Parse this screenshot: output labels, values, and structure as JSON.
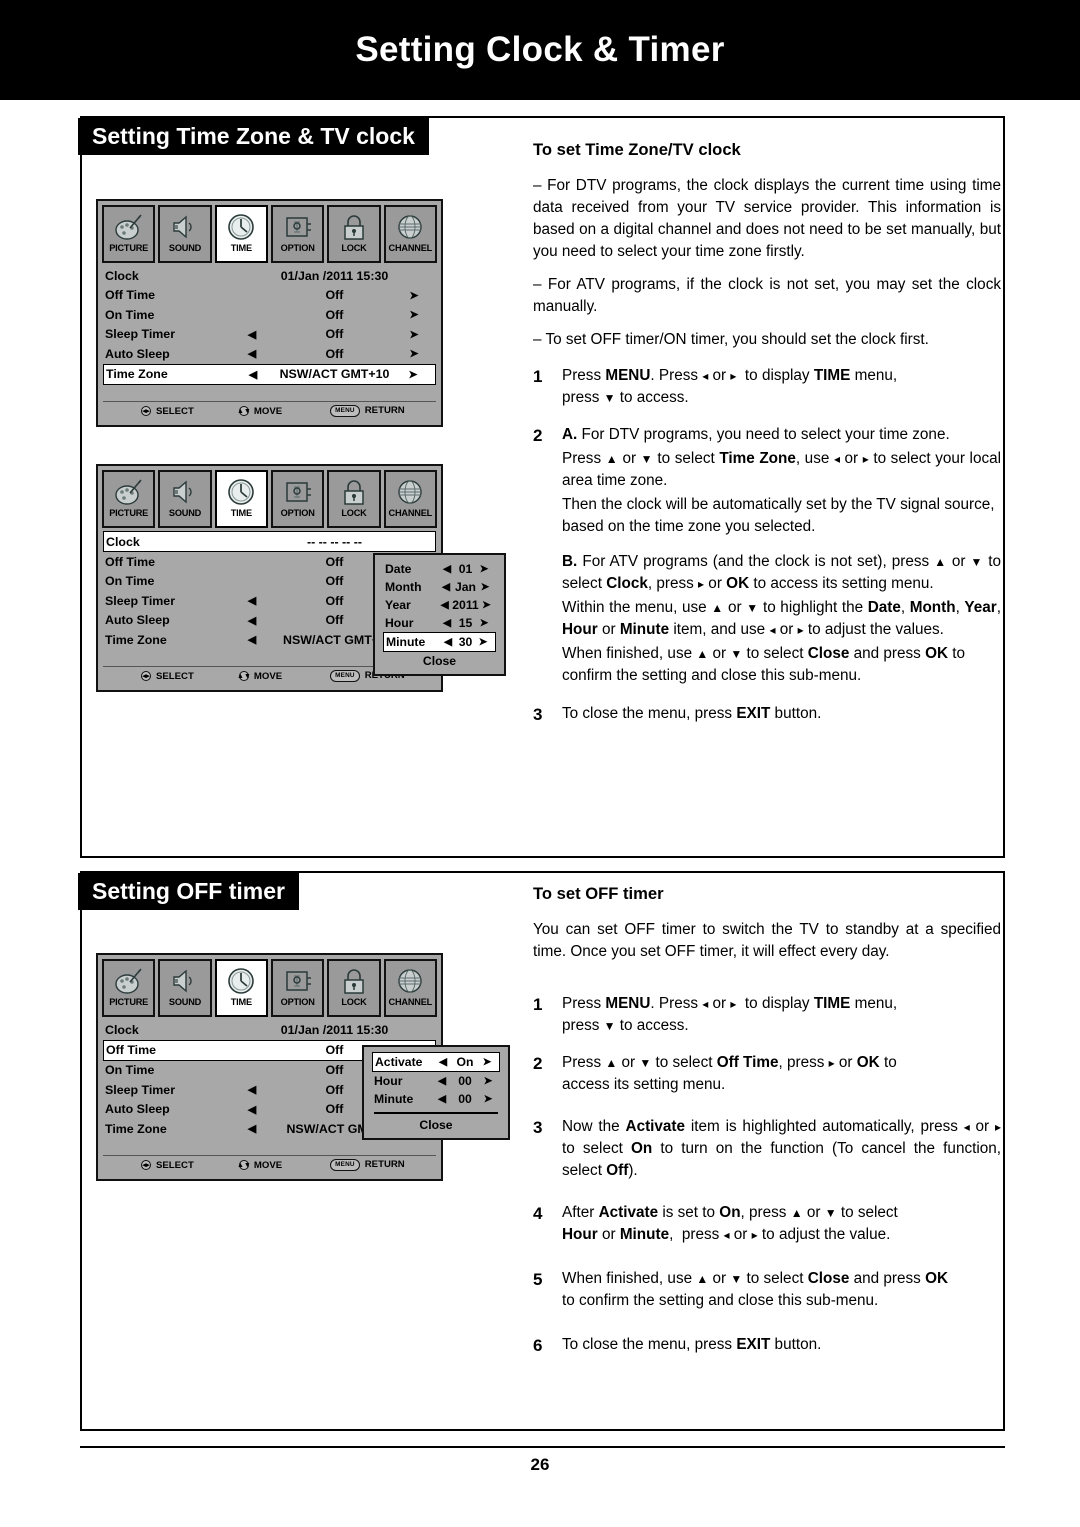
{
  "page": {
    "banner_title": "Setting Clock & Timer",
    "page_number": "26"
  },
  "sections": {
    "timezone": {
      "tag": "Setting Time Zone & TV clock",
      "subhead": "To set Time Zone/TV clock",
      "paragraphs": [
        "– For DTV programs, the clock displays the current time using time data received from your TV service provider. This information is based on a digital channel and does not need to be set manually, but you need to select your time zone firstly.",
        "– For ATV programs, if the clock is not set, you may set the clock manually.",
        "– To set OFF timer/ON timer, you should set the clock first."
      ],
      "steps": [
        {
          "num": "1"
        },
        {
          "num": "2"
        },
        {
          "num": "3"
        }
      ]
    },
    "offtimer": {
      "tag": "Setting OFF timer",
      "subhead": "To set OFF timer",
      "paragraphs": [
        "You can set OFF timer to switch the TV to standby at a specified time.  Once you set OFF timer, it will effect every day."
      ],
      "steps": [
        {
          "num": "1"
        },
        {
          "num": "2"
        },
        {
          "num": "3"
        },
        {
          "num": "4"
        },
        {
          "num": "5"
        },
        {
          "num": "6"
        }
      ]
    }
  },
  "osd": {
    "icons": [
      {
        "label": "PICTURE",
        "icon": "picture-palette-icon"
      },
      {
        "label": "SOUND",
        "icon": "speaker-icon"
      },
      {
        "label": "TIME",
        "icon": "clock-icon"
      },
      {
        "label": "OPTION",
        "icon": "wrench-tool-icon"
      },
      {
        "label": "LOCK",
        "icon": "padlock-icon"
      },
      {
        "label": "CHANNEL",
        "icon": "globe-icon"
      }
    ],
    "active_icon": "TIME",
    "footer": {
      "select_key": "◂▸",
      "select_label": "SELECT",
      "move_key": "ⒶⓋ",
      "move_label": "MOVE",
      "return_key": "MENU",
      "return_label": "RETURN"
    },
    "menu1": {
      "rows": [
        {
          "label": "Clock",
          "left": "",
          "value": "01/Jan  /2011 15:30",
          "right": "",
          "highlight": false
        },
        {
          "label": "Off Time",
          "left": "",
          "value": "Off",
          "right": "➤",
          "highlight": false
        },
        {
          "label": "On Time",
          "left": "",
          "value": "Off",
          "right": "➤",
          "highlight": false
        },
        {
          "label": "Sleep Timer",
          "left": "◀",
          "value": "Off",
          "right": "➤",
          "highlight": false
        },
        {
          "label": "Auto Sleep",
          "left": "◀",
          "value": "Off",
          "right": "➤",
          "highlight": false
        },
        {
          "label": "Time Zone",
          "left": "◀",
          "value": "NSW/ACT GMT+10",
          "right": "➤",
          "highlight": true
        }
      ]
    },
    "menu2": {
      "rows": [
        {
          "label": "Clock",
          "left": "",
          "value": "--  --  --   --  --",
          "right": "",
          "highlight": true
        },
        {
          "label": "Off Time",
          "left": "",
          "value": "Off",
          "right": "",
          "highlight": false
        },
        {
          "label": "On Time",
          "left": "",
          "value": "Off",
          "right": "",
          "highlight": false
        },
        {
          "label": "Sleep Timer",
          "left": "◀",
          "value": "Off",
          "right": "",
          "highlight": false
        },
        {
          "label": "Auto Sleep",
          "left": "◀",
          "value": "Off",
          "right": "",
          "highlight": false
        },
        {
          "label": "Time Zone",
          "left": "◀",
          "value": "NSW/ACT GMT+1",
          "right": "",
          "highlight": false
        }
      ],
      "dialog": {
        "rows": [
          {
            "label": "Date",
            "left": "◀",
            "value": "01",
            "right": "➤",
            "highlight": false
          },
          {
            "label": "Month",
            "left": "◀",
            "value": "Jan",
            "right": "➤",
            "highlight": false
          },
          {
            "label": "Year",
            "left": "◀",
            "value": "2011",
            "right": "➤",
            "highlight": false
          },
          {
            "label": "Hour",
            "left": "◀",
            "value": "15",
            "right": "➤",
            "highlight": false
          },
          {
            "label": "Minute",
            "left": "◀",
            "value": "30",
            "right": "➤",
            "highlight": true
          }
        ],
        "close_label": "Close"
      }
    },
    "menu3": {
      "rows": [
        {
          "label": "Clock",
          "left": "",
          "value": "01/Jan  /2011 15:30",
          "right": "",
          "highlight": false
        },
        {
          "label": "Off Time",
          "left": "",
          "value": "Off",
          "right": "",
          "highlight": true
        },
        {
          "label": "On Time",
          "left": "",
          "value": "Off",
          "right": "",
          "highlight": false
        },
        {
          "label": "Sleep Timer",
          "left": "◀",
          "value": "Off",
          "right": "",
          "highlight": false
        },
        {
          "label": "Auto Sleep",
          "left": "◀",
          "value": "Off",
          "right": "",
          "highlight": false
        },
        {
          "label": "Time Zone",
          "left": "◀",
          "value": "NSW/ACT GMT+",
          "right": "",
          "highlight": false
        }
      ],
      "dialog": {
        "rows": [
          {
            "label": "Activate",
            "left": "◀",
            "value": "On",
            "right": "➤",
            "highlight": true
          },
          {
            "label": "Hour",
            "left": "◀",
            "value": "00",
            "right": "➤",
            "highlight": false
          },
          {
            "label": "Minute",
            "left": "◀",
            "value": "00",
            "right": "➤",
            "highlight": false
          }
        ],
        "close_label": "Close"
      }
    }
  }
}
